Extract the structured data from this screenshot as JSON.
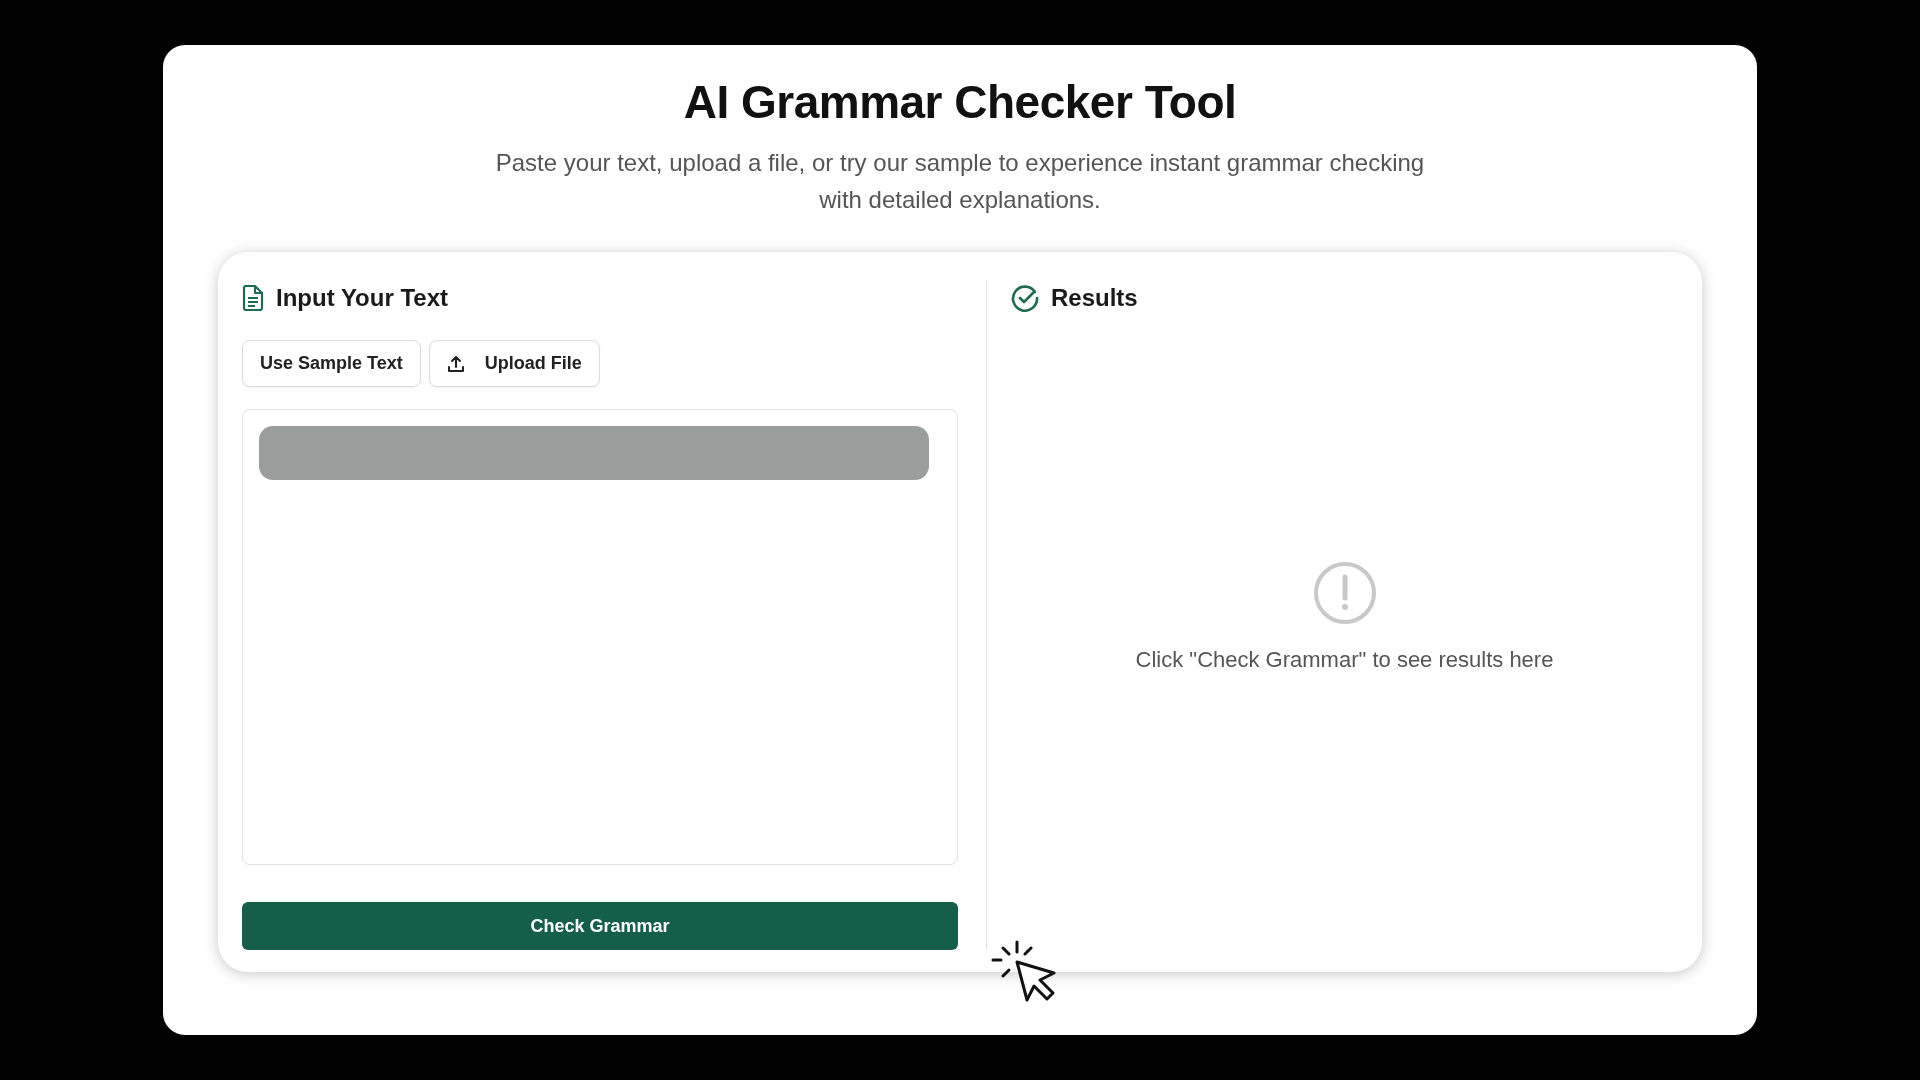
{
  "title": "AI Grammar Checker Tool",
  "subtitle": "Paste your text, upload a file, or try our sample to experience instant grammar checking with detailed explanations.",
  "input_panel": {
    "heading": "Input Your Text",
    "buttons": [
      {
        "label": "Use Sample Text",
        "kind": "plain"
      },
      {
        "label": "Upload File",
        "kind": "upload"
      }
    ],
    "submit": "Check Grammar"
  },
  "results_panel": {
    "heading": "Results",
    "empty_message": "Click \"Check Grammar\" to see results here"
  }
}
